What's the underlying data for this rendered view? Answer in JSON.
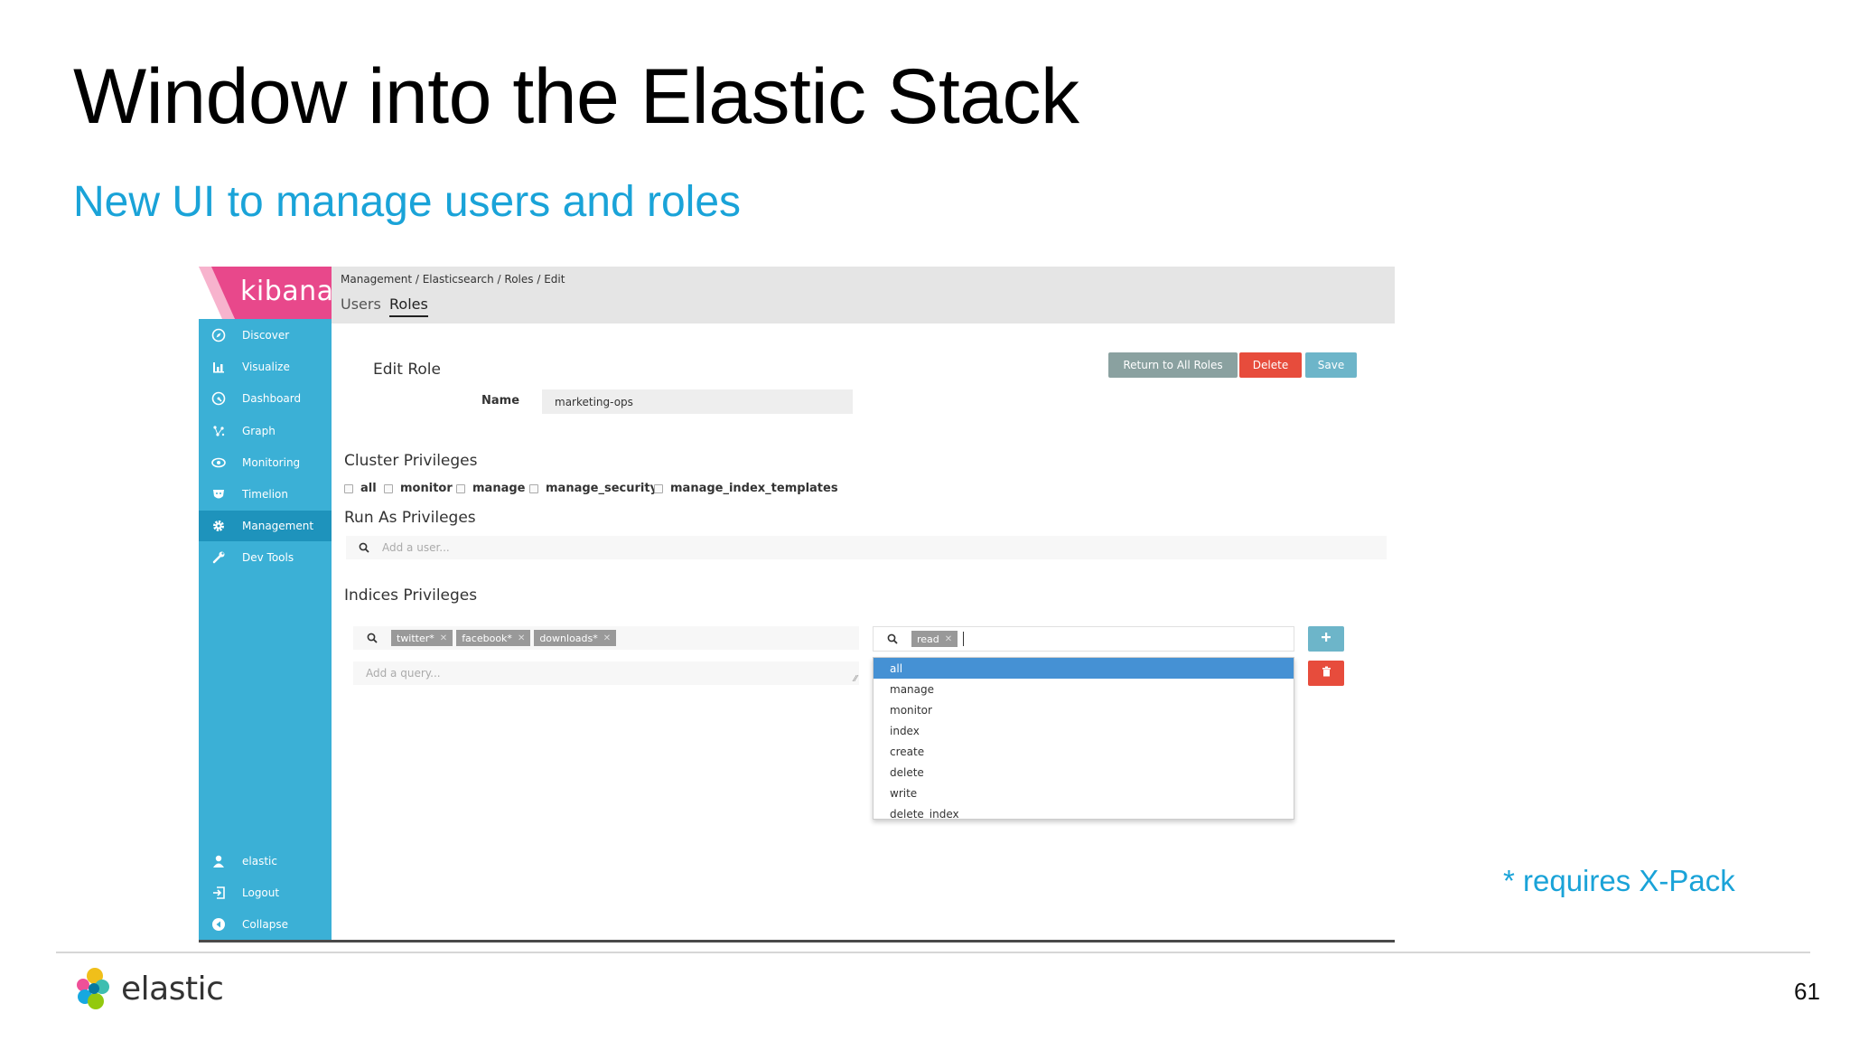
{
  "slide": {
    "title": "Window into the Elastic Stack",
    "subtitle": "New UI to manage users and roles",
    "note": "* requires X-Pack",
    "page_number": "61",
    "logo_text": "elastic"
  },
  "kibana": {
    "logo_text": "kibana",
    "breadcrumb": "Management / Elasticsearch / Roles / Edit",
    "tabs": [
      {
        "label": "Users"
      },
      {
        "label": "Roles"
      }
    ],
    "nav": [
      {
        "label": "Discover",
        "icon": "compass-icon"
      },
      {
        "label": "Visualize",
        "icon": "bar-chart-icon"
      },
      {
        "label": "Dashboard",
        "icon": "dashboard-icon"
      },
      {
        "label": "Graph",
        "icon": "graph-icon"
      },
      {
        "label": "Monitoring",
        "icon": "eye-icon"
      },
      {
        "label": "Timelion",
        "icon": "timelion-icon"
      },
      {
        "label": "Management",
        "icon": "gear-icon"
      },
      {
        "label": "Dev Tools",
        "icon": "wrench-icon"
      }
    ],
    "nav_bottom": [
      {
        "label": "elastic",
        "icon": "user-icon"
      },
      {
        "label": "Logout",
        "icon": "logout-icon"
      },
      {
        "label": "Collapse",
        "icon": "collapse-icon"
      }
    ],
    "edit_role_heading": "Edit Role",
    "buttons": {
      "return": "Return to All Roles",
      "delete": "Delete",
      "save": "Save"
    },
    "name_label": "Name",
    "name_value": "marketing-ops",
    "cluster_heading": "Cluster Privileges",
    "cluster_privileges": [
      "all",
      "monitor",
      "manage",
      "manage_security",
      "manage_index_templates"
    ],
    "run_as_heading": "Run As Privileges",
    "run_as_placeholder": "Add a user...",
    "indices_heading": "Indices Privileges",
    "index_tags": [
      "twitter*",
      "facebook*",
      "downloads*"
    ],
    "query_placeholder": "Add a query...",
    "privilege_tags": [
      "read"
    ],
    "dropdown_options": [
      "all",
      "manage",
      "monitor",
      "index",
      "create",
      "delete",
      "write",
      "delete_index"
    ],
    "dropdown_selected": "all"
  },
  "colors": {
    "accent": "#1aa3d8",
    "sidebar": "#3bb0d6",
    "kibana_pink": "#e8488b",
    "delete_red": "#e74c3c",
    "save_blue": "#6db5c9",
    "return_gray": "#8aa1a0"
  }
}
